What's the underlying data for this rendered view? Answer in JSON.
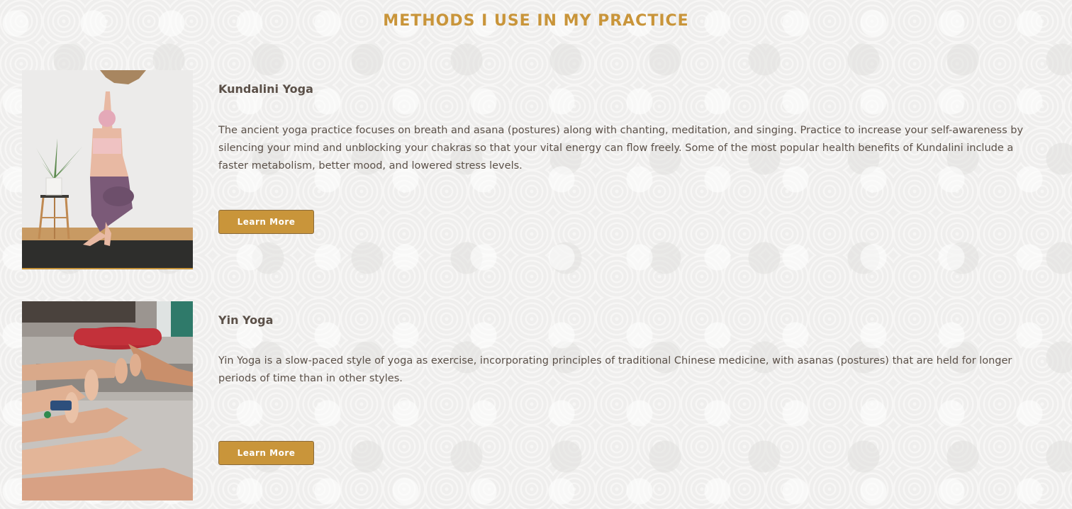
{
  "section": {
    "title": "METHODS I USE IN MY PRACTICE"
  },
  "methods": [
    {
      "name": "Kundalini Yoga",
      "description": "The ancient yoga practice focuses on breath and asana (postures) along with chanting, meditation, and singing. Practice to increase your self-awareness by silencing your mind and unblocking your chakras so that your vital energy can flow freely. Some of the most popular health benefits of Kundalini include a faster metabolism, better mood, and lowered stress levels.",
      "button_label": "Learn More"
    },
    {
      "name": "Yin Yoga",
      "description": "Yin Yoga is a slow-paced style of yoga as exercise, incorporating principles of traditional Chinese medicine, with asanas (postures) that are held for longer periods of time than in other styles.",
      "button_label": "Learn More"
    }
  ],
  "colors": {
    "accent": "#c9953a",
    "text": "#5b5048",
    "background": "#f2f1f0"
  }
}
